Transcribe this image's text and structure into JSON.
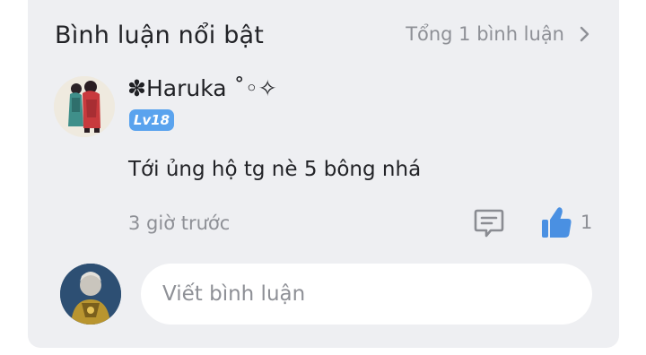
{
  "header": {
    "title": "Bình luận nổi bật",
    "total_label": "Tổng 1 bình luận",
    "chevron_icon": "chevron-right-icon"
  },
  "comment": {
    "avatar_icon": "anime-characters-avatar",
    "username": "✽Haruka ˚◦✧",
    "level": "Lv18",
    "level_color": "#5aa3ee",
    "text": "Tới ủng hộ tg nè 5 bông nhá",
    "timestamp": "3 giờ trước",
    "reply_icon": "comment-bubble-icon",
    "like_icon": "thumbs-up-icon",
    "like_count": "1",
    "like_color": "#4a90e2"
  },
  "composer": {
    "avatar_icon": "user-avatar",
    "placeholder": "Viết bình luận"
  }
}
